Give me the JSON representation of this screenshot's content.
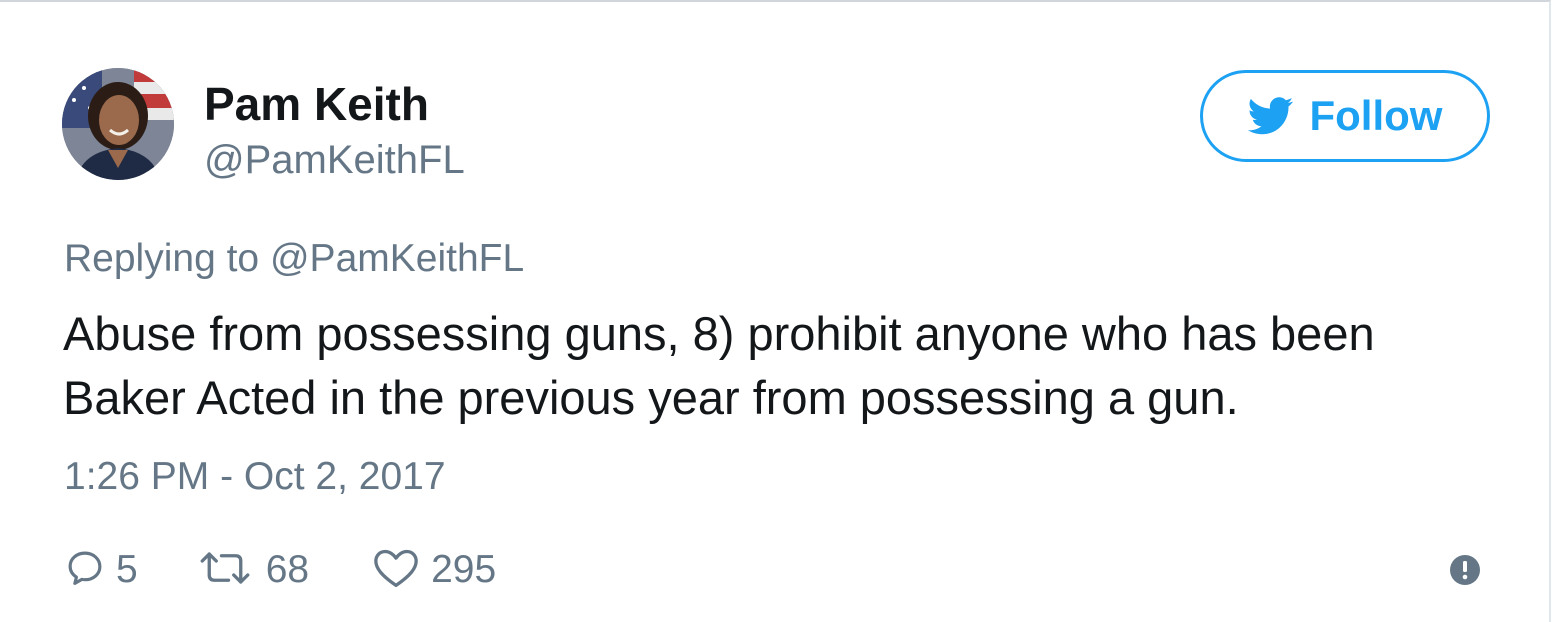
{
  "tweet": {
    "author": {
      "name": "Pam Keith",
      "handle": "@PamKeithFL",
      "avatar_icon": "avatar-photo"
    },
    "follow_button": {
      "label": "Follow",
      "icon": "twitter-bird-icon",
      "color": "#1da1f2"
    },
    "reply_to": {
      "prefix": "Replying to",
      "handle": "@PamKeithFL"
    },
    "text": "Abuse from possessing guns, 8) prohibit anyone who has been Baker Acted in the previous year from possessing a gun.",
    "timestamp": "1:26 PM - Oct 2, 2017",
    "actions": {
      "replies": "5",
      "retweets": "68",
      "likes": "295"
    },
    "icons": {
      "reply": "reply-bubble-icon",
      "retweet": "retweet-icon",
      "like": "heart-icon",
      "info": "info-icon"
    },
    "colors": {
      "text": "#14171a",
      "muted": "#657786",
      "accent": "#1da1f2"
    }
  }
}
